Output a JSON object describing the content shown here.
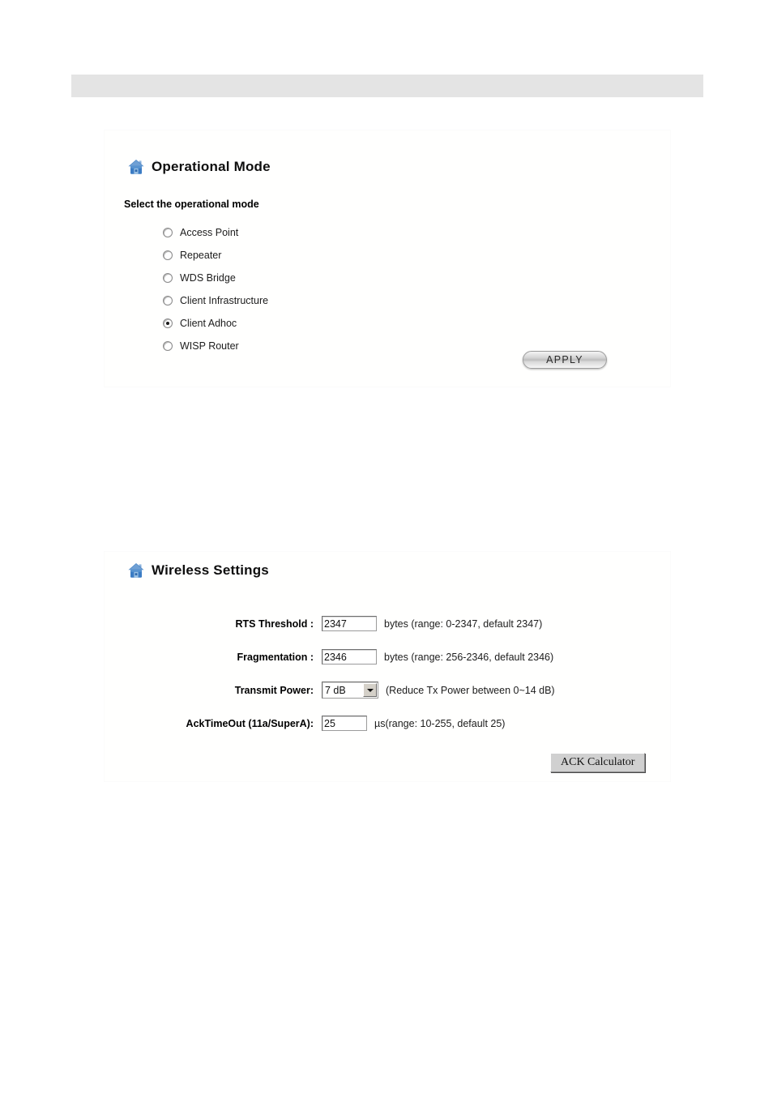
{
  "header": {
    "bar_label": ""
  },
  "operational_mode": {
    "icon": "house-icon",
    "title": "Operational Mode",
    "instruction": "Select the operational mode",
    "options": [
      {
        "label": "Access Point",
        "selected": false
      },
      {
        "label": "Repeater",
        "selected": false
      },
      {
        "label": "WDS Bridge",
        "selected": false
      },
      {
        "label": "Client Infrastructure",
        "selected": false
      },
      {
        "label": "Client Adhoc",
        "selected": true
      },
      {
        "label": "WISP Router",
        "selected": false
      }
    ],
    "apply_label": "APPLY"
  },
  "wireless_settings": {
    "icon": "house-icon",
    "title": "Wireless Settings",
    "fields": [
      {
        "label": "RTS Threshold :",
        "value": "2347",
        "hint": "bytes (range: 0-2347, default 2347)"
      },
      {
        "label": "Fragmentation :",
        "value": "2346",
        "hint": "bytes (range: 256-2346, default 2346)"
      },
      {
        "label": "Transmit Power:",
        "value": "7 dB",
        "hint": "(Reduce Tx Power between 0~14 dB)"
      },
      {
        "label": "AckTimeOut (11a/SuperA):",
        "value": "25",
        "hint": "µs(range: 10-255, default 25)"
      }
    ],
    "ack_button_label": "ACK Calculator"
  },
  "colors": {
    "icon_blue": "#3b7cc4",
    "header_gray": "#e4e4e4",
    "button_face": "#d0d0d0"
  }
}
